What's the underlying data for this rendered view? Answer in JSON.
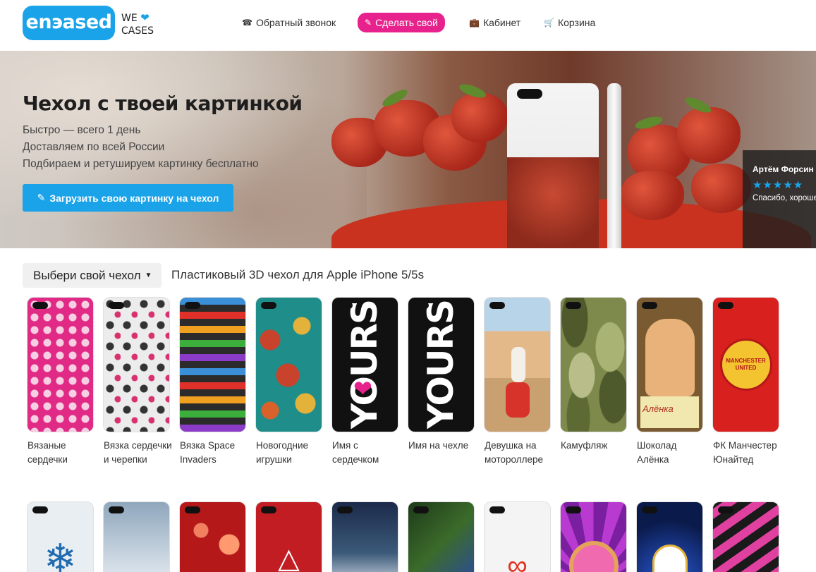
{
  "header": {
    "logo_text": "enэased",
    "tagline_we": "WE",
    "tagline_cases": "CASES",
    "nav": {
      "callback": "Обратный звонок",
      "make": "Сделать свой",
      "cabinet": "Кабинет",
      "cart": "Корзина"
    }
  },
  "hero": {
    "title": "Чехол с твоей картинкой",
    "lines": [
      "Быстро — всего 1 день",
      "Доставляем по всей России",
      "Подбираем и ретушируем картинку бесплатно"
    ],
    "upload_button": "Загрузить свою картинку на чехол",
    "review": {
      "name": "Артём Форсин",
      "stars": "★★★★★",
      "text": "Спасибо, хороше"
    }
  },
  "selector": {
    "label": "Выбери свой чехол",
    "model": "Пластиковый 3D чехол для Apple iPhone 5/5s"
  },
  "products": [
    {
      "name": "Вязаные сердечки"
    },
    {
      "name": "Вязка сердечки и черепки"
    },
    {
      "name": "Вязка Space Invaders"
    },
    {
      "name": "Новогодние игрушки"
    },
    {
      "name": "Имя с сердечком",
      "art_text": "YOURS"
    },
    {
      "name": "Имя на чехле",
      "art_text": "YOURS"
    },
    {
      "name": "Девушка на мотороллере"
    },
    {
      "name": "Камуфляж"
    },
    {
      "name": "Шоколад Алёнка",
      "art_text": "Алёнка"
    },
    {
      "name": "ФК Манчестер Юнайтед",
      "art_text": "MANCHESTER UNITED"
    }
  ],
  "colors": {
    "brand_blue": "#1aa3e8",
    "brand_pink": "#e8228c"
  }
}
